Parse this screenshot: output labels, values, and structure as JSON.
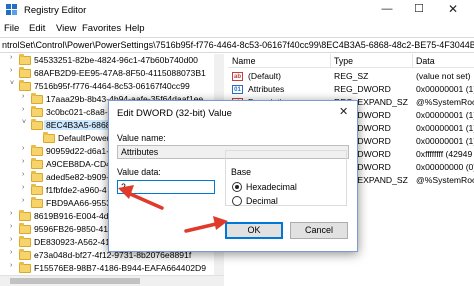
{
  "window": {
    "title": "Registry Editor",
    "min_glyph": "—",
    "max_glyph": "☐",
    "close_glyph": "✕"
  },
  "menu": [
    "File",
    "Edit",
    "View",
    "Favorites",
    "Help"
  ],
  "address": "ntrolSet\\Control\\Power\\PowerSettings\\7516b95f-f776-4464-8c53-06167f40cc99\\8EC4B3A5-6868-48c2-BE75-4F3044BE88A7",
  "tree": [
    {
      "label": "54533251-82be-4824-96c1-47b60b740d00",
      "arrow": "›",
      "selected": false
    },
    {
      "label": "68AFB2D9-EE95-47A8-8F50-4115088073B1",
      "arrow": "›",
      "selected": false
    },
    {
      "label": "7516b95f-f776-4464-8c53-06167f40cc99",
      "arrow": "˅",
      "selected": false
    },
    {
      "label": "17aaa29b-8b43-4b94-aafe-35f64daaf1ee",
      "arrow": "›",
      "selected": false
    },
    {
      "label": "3c0bc021-c8a8-",
      "arrow": "›",
      "selected": false
    },
    {
      "label": "8EC4B3A5-6868-",
      "arrow": "˅",
      "selected": true
    },
    {
      "label": "DefaultPowerS",
      "arrow": "",
      "selected": false
    },
    {
      "label": "90959d22-d6a1-",
      "arrow": "›",
      "selected": false
    },
    {
      "label": "A9CEB8DA-CD4",
      "arrow": "›",
      "selected": false
    },
    {
      "label": "aded5e82-b909-",
      "arrow": "›",
      "selected": false
    },
    {
      "label": "f1fbfde2-a960-4",
      "arrow": "›",
      "selected": false
    },
    {
      "label": "FBD9AA66-9553-",
      "arrow": "›",
      "selected": false
    },
    {
      "label": "8619B916-E004-4dd",
      "arrow": "›",
      "selected": false
    },
    {
      "label": "9596FB26-9850-41f",
      "arrow": "›",
      "selected": false
    },
    {
      "label": "DE830923-A562-41",
      "arrow": "›",
      "selected": false
    },
    {
      "label": "e73a048d-bf27-4f12-9731-8b2076e8891f",
      "arrow": "›",
      "selected": false
    },
    {
      "label": "F15576E8-98B7-4186-B944-EAFA664402D9",
      "arrow": "›",
      "selected": false
    }
  ],
  "list": {
    "headers": [
      "Name",
      "Type",
      "Data"
    ],
    "rows": [
      {
        "icon": "ab",
        "name": "(Default)",
        "type": "REG_SZ",
        "data": "(value not set)"
      },
      {
        "icon": "bin",
        "name": "Attributes",
        "type": "REG_DWORD",
        "data": "0x00000001 (1)"
      },
      {
        "icon": "ab",
        "name": "Description",
        "type": "REG_EXPAND_SZ",
        "data": "@%SystemRoo"
      },
      {
        "icon": "bin",
        "name": "",
        "type": "REG_DWORD",
        "data": "0x00000001 (1)"
      },
      {
        "icon": "bin",
        "name": "",
        "type": "REG_DWORD",
        "data": "0x00000001 (1)"
      },
      {
        "icon": "bin",
        "name": "",
        "type": "REG_DWORD",
        "data": "0x00000001 (1)"
      },
      {
        "icon": "bin",
        "name": "",
        "type": "REG_DWORD",
        "data": "0xffffffff (42949"
      },
      {
        "icon": "bin",
        "name": "",
        "type": "REG_DWORD",
        "data": "0x00000000 (0)"
      },
      {
        "icon": "ab",
        "name": "",
        "type": "REG_EXPAND_SZ",
        "data": "@%SystemRoo"
      }
    ]
  },
  "dialog": {
    "title": "Edit DWORD (32-bit) Value",
    "close_glyph": "✕",
    "value_name_label": "Value name:",
    "value_name": "Attributes",
    "value_data_label": "Value data:",
    "value_data": "2",
    "base_label": "Base",
    "hex_label": "Hexadecimal",
    "dec_label": "Decimal",
    "base_selected": "Hexadecimal",
    "ok_label": "OK",
    "cancel_label": "Cancel"
  },
  "colors": {
    "annotation_arrow": "#e03a2b",
    "selection": "#cce8ff",
    "focus_border": "#0078d7"
  }
}
